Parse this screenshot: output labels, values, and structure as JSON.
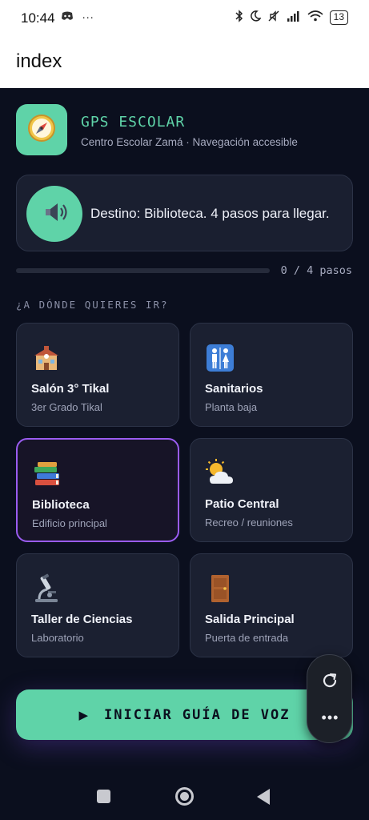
{
  "status_bar": {
    "time": "10:44",
    "left_icons": [
      "discord-icon",
      "more-dots-icon"
    ],
    "right_icons": [
      "bluetooth-icon",
      "moon-icon",
      "mute-icon",
      "signal-icon",
      "wifi-icon"
    ],
    "battery": "13"
  },
  "app_bar": {
    "title": "index"
  },
  "header": {
    "brand": "GPS ESCOLAR",
    "subtitle": "Centro Escolar Zamá · Navegación accesible",
    "logo_icon": "compass-icon"
  },
  "announcement": {
    "icon": "speaker-icon",
    "text": "Destino: Biblioteca. 4 pasos para llegar."
  },
  "progress": {
    "label": "0 / 4 pasos",
    "value": 0
  },
  "section_label": "¿A DÓNDE QUIERES IR?",
  "destinations": [
    {
      "title": "Salón 3° Tikal",
      "subtitle": "3er Grado Tikal",
      "icon": "school-icon",
      "selected": false
    },
    {
      "title": "Sanitarios",
      "subtitle": "Planta baja",
      "icon": "restroom-icon",
      "selected": false
    },
    {
      "title": "Biblioteca",
      "subtitle": "Edificio principal",
      "icon": "books-icon",
      "selected": true
    },
    {
      "title": "Patio Central",
      "subtitle": "Recreo / reuniones",
      "icon": "sun-cloud-icon",
      "selected": false
    },
    {
      "title": "Taller de Ciencias",
      "subtitle": "Laboratorio",
      "icon": "microscope-icon",
      "selected": false
    },
    {
      "title": "Salida Principal",
      "subtitle": "Puerta de entrada",
      "icon": "door-icon",
      "selected": false
    }
  ],
  "start_button": {
    "label": "INICIAR GUÍA DE VOZ",
    "icon": "play-icon"
  },
  "floating_toolbar": {
    "icons": [
      "refresh-icon",
      "more-icon"
    ],
    "more_label": "•••"
  },
  "colors": {
    "background": "#0b0f1e",
    "accent": "#5fd3a8",
    "selected_border": "#9a5cf0",
    "card": "#1b2031"
  }
}
